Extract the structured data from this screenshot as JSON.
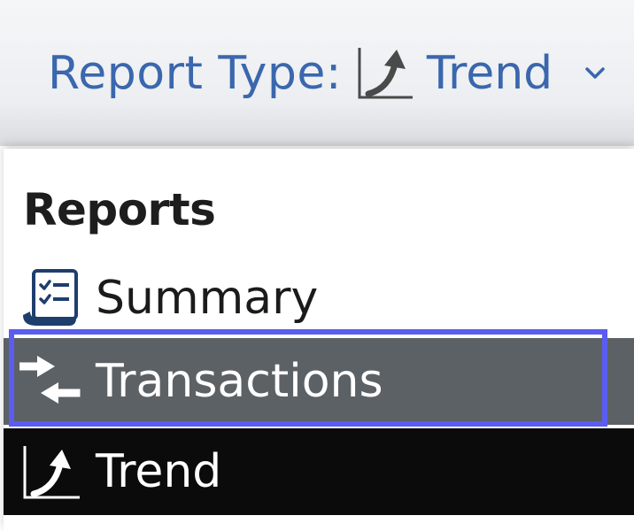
{
  "header": {
    "label": "Report Type:",
    "value": "Trend",
    "value_icon": "trend-icon",
    "chevron_icon": "chevron-down-icon"
  },
  "menu": {
    "heading": "Reports",
    "items": [
      {
        "label": "Summary",
        "icon": "summary-checklist-icon",
        "state": "normal"
      },
      {
        "label": "Transactions",
        "icon": "transactions-arrows-icon",
        "state": "focused"
      },
      {
        "label": "Trend",
        "icon": "trend-icon",
        "state": "selected"
      }
    ]
  },
  "colors": {
    "header_text": "#3a67ad",
    "focus_ring": "#5b5cf0",
    "focused_bg": "#5c6165",
    "selected_bg": "#0b0b0b",
    "icon_navy": "#1e3e6e"
  }
}
